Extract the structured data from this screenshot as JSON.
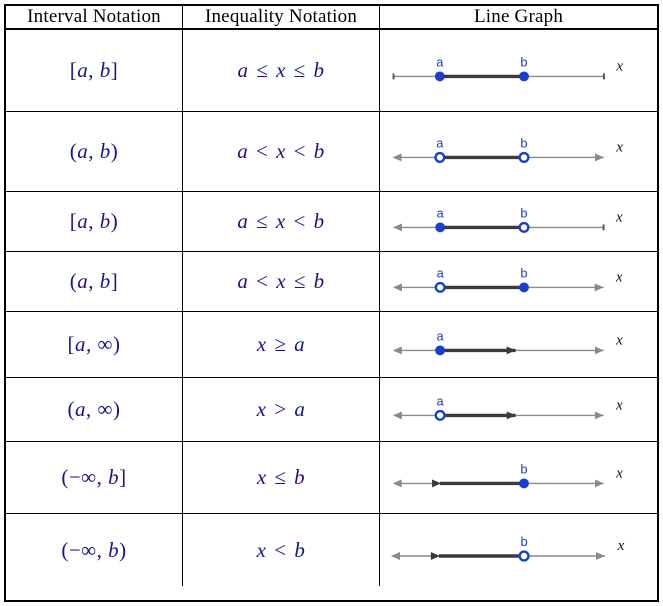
{
  "table": {
    "headers": [
      {
        "label": "Interval Notation",
        "name": "header-interval-notation"
      },
      {
        "label": "Inequality Notation",
        "name": "header-inequality-notation"
      },
      {
        "label": "Line Graph",
        "name": "header-line-graph"
      }
    ],
    "rows": [
      {
        "interval": "[a, b]",
        "inequality": "a ≤ x ≤ b",
        "graph": {
          "left_endpoint": {
            "label": "a",
            "type": "closed",
            "x": 0.22
          },
          "right_endpoint": {
            "label": "b",
            "type": "closed",
            "x": 0.62
          },
          "segment": "between",
          "axis_left_end": "tick",
          "axis_right_end": "tick",
          "axis_label": "x"
        }
      },
      {
        "interval": "(a, b)",
        "inequality": "a < x < b",
        "graph": {
          "left_endpoint": {
            "label": "a",
            "type": "open",
            "x": 0.22
          },
          "right_endpoint": {
            "label": "b",
            "type": "open",
            "x": 0.62
          },
          "segment": "between",
          "axis_left_end": "arrow",
          "axis_right_end": "arrow",
          "axis_label": "x"
        }
      },
      {
        "interval": "[a, b)",
        "inequality": "a ≤ x < b",
        "graph": {
          "left_endpoint": {
            "label": "a",
            "type": "closed",
            "x": 0.22
          },
          "right_endpoint": {
            "label": "b",
            "type": "open",
            "x": 0.62
          },
          "segment": "between",
          "axis_left_end": "arrow",
          "axis_right_end": "tick",
          "axis_label": "x"
        }
      },
      {
        "interval": "(a, b]",
        "inequality": "a < x ≤ b",
        "graph": {
          "left_endpoint": {
            "label": "a",
            "type": "open",
            "x": 0.22
          },
          "right_endpoint": {
            "label": "b",
            "type": "closed",
            "x": 0.62
          },
          "segment": "between",
          "axis_left_end": "arrow",
          "axis_right_end": "arrow",
          "axis_label": "x"
        }
      },
      {
        "interval": "[a, ∞)",
        "inequality": "x ≥ a",
        "graph": {
          "left_endpoint": {
            "label": "a",
            "type": "closed",
            "x": 0.22
          },
          "right_endpoint": null,
          "segment": "ray-right",
          "ray_end": 0.58,
          "axis_left_end": "arrow",
          "axis_right_end": "arrow",
          "axis_label": "x"
        }
      },
      {
        "interval": "(a, ∞)",
        "inequality": "x > a",
        "graph": {
          "left_endpoint": {
            "label": "a",
            "type": "open",
            "x": 0.22
          },
          "right_endpoint": null,
          "segment": "ray-right",
          "ray_end": 0.58,
          "axis_left_end": "arrow",
          "axis_right_end": "arrow",
          "axis_label": "x"
        }
      },
      {
        "interval": "(−∞, b]",
        "inequality": "x ≤ b",
        "graph": {
          "left_endpoint": null,
          "right_endpoint": {
            "label": "b",
            "type": "closed",
            "x": 0.62
          },
          "segment": "ray-left",
          "ray_end": 0.22,
          "axis_left_end": "arrow",
          "axis_right_end": "arrow",
          "axis_label": "x"
        }
      },
      {
        "interval": "(−∞, b)",
        "inequality": "x < b",
        "graph": {
          "left_endpoint": null,
          "right_endpoint": {
            "label": "b",
            "type": "open",
            "x": 0.62
          },
          "segment": "ray-left",
          "ray_end": 0.22,
          "axis_left_end": "arrow",
          "axis_right_end": "arrow",
          "axis_label": "x"
        }
      }
    ]
  },
  "colors": {
    "notation_blue": "#16168c",
    "point_blue": "#1a3fcc",
    "axis_gray": "#8a8a8a",
    "segment_dark": "#3a3a3a",
    "border": "#000000"
  }
}
